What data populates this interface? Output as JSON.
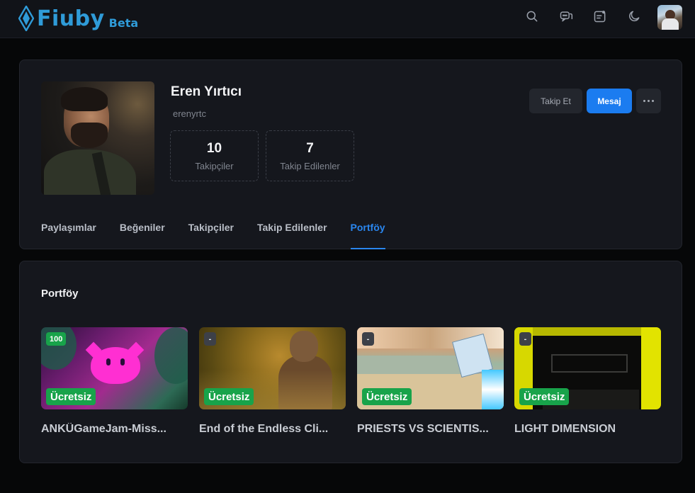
{
  "header": {
    "logo_text": "Fiuby",
    "logo_badge": "Beta",
    "icons": [
      "search-icon",
      "chat-icon",
      "notes-icon",
      "moon-icon"
    ]
  },
  "profile": {
    "name": "Eren Yırtıcı",
    "handle": "erenyrtc",
    "followers_count": "10",
    "followers_label": "Takipçiler",
    "following_count": "7",
    "following_label": "Takip Edilenler",
    "follow_button": "Takip Et",
    "message_button": "Mesaj"
  },
  "tabs": [
    {
      "label": "Paylaşımlar",
      "active": false
    },
    {
      "label": "Beğeniler",
      "active": false
    },
    {
      "label": "Takipçiler",
      "active": false
    },
    {
      "label": "Takip Edilenler",
      "active": false
    },
    {
      "label": "Portföy",
      "active": true
    }
  ],
  "portfolio": {
    "title": "Portföy",
    "games": [
      {
        "title": "ANKÜGameJam-Miss...",
        "rating": "100",
        "price": "Ücretsiz"
      },
      {
        "title": "End of the Endless Cli...",
        "rating": "-",
        "price": "Ücretsiz"
      },
      {
        "title": "PRIESTS VS SCIENTIS...",
        "rating": "-",
        "price": "Ücretsiz"
      },
      {
        "title": "LIGHT DIMENSION",
        "rating": "-",
        "price": "Ücretsiz"
      }
    ]
  },
  "colors": {
    "accent": "#1b7cf0",
    "brand": "#2f9bd8",
    "success": "#18a34a",
    "background": "#060708",
    "card": "#15171d"
  }
}
